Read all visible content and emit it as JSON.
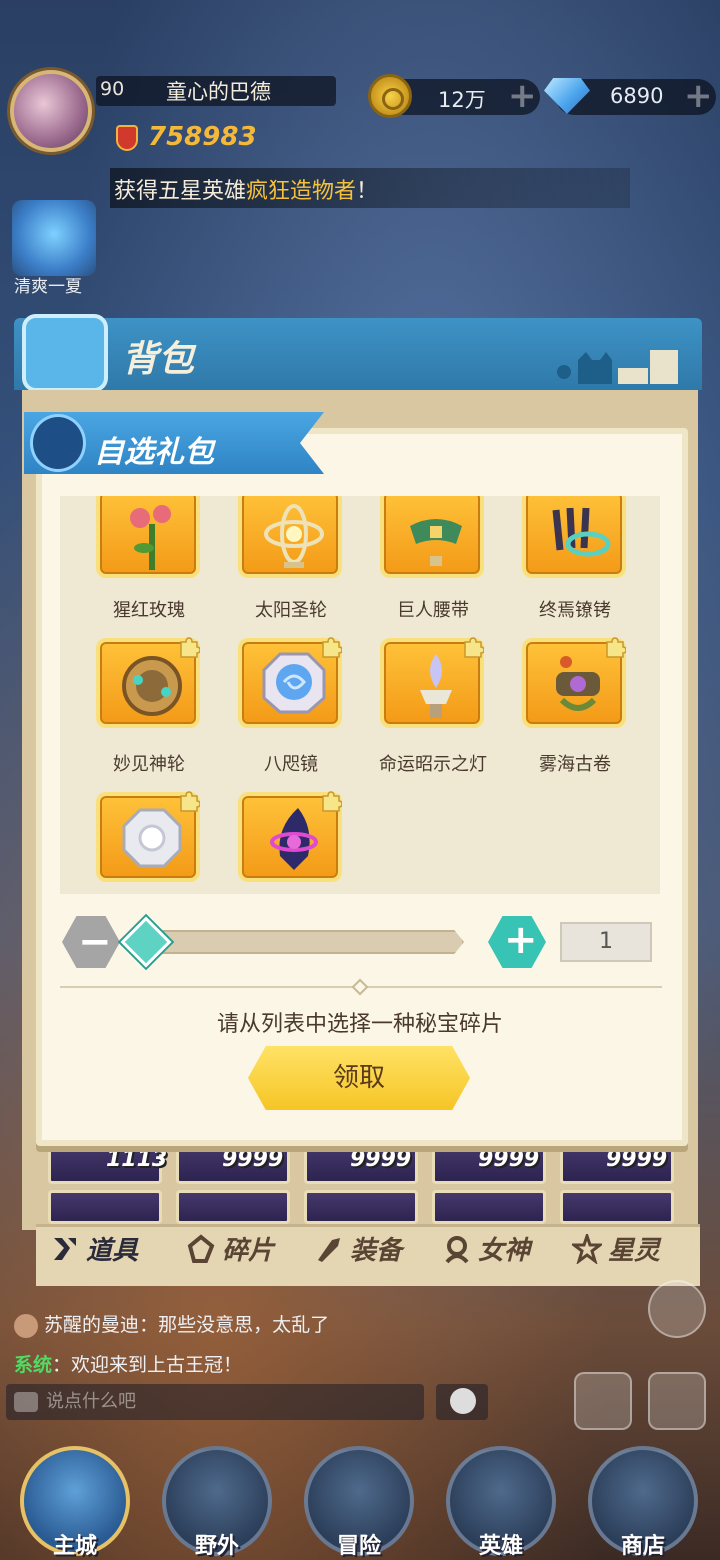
{
  "player": {
    "level": "90",
    "name": "童心的巴德",
    "power": "758983"
  },
  "resources": {
    "gold": "12万",
    "diamonds": "6890"
  },
  "ticker": {
    "prefix": "获得五星英雄",
    "highlight": "疯狂造物者",
    "suffix": "！"
  },
  "pet": {
    "label": "清爽一夏"
  },
  "bag": {
    "title": "背包",
    "grid_counts": [
      "1113",
      "9999",
      "9999",
      "9999",
      "9999"
    ],
    "tabs": [
      {
        "label": "道具",
        "icon": "items-icon"
      },
      {
        "label": "碎片",
        "icon": "shards-icon"
      },
      {
        "label": "装备",
        "icon": "equipment-icon"
      },
      {
        "label": "女神",
        "icon": "goddess-icon"
      },
      {
        "label": "星灵",
        "icon": "star-spirit-icon"
      }
    ]
  },
  "modal": {
    "title": "自选礼包",
    "items": [
      {
        "name": "猩红玫瑰",
        "icon": "crimson-rose-icon"
      },
      {
        "name": "太阳圣轮",
        "icon": "sun-wheel-icon"
      },
      {
        "name": "巨人腰带",
        "icon": "giant-belt-icon"
      },
      {
        "name": "终焉镣铐",
        "icon": "shackles-icon"
      },
      {
        "name": "妙见神轮",
        "icon": "divine-wheel-icon"
      },
      {
        "name": "八咫镜",
        "icon": "yata-mirror-icon"
      },
      {
        "name": "命运昭示之灯",
        "icon": "fate-lamp-icon"
      },
      {
        "name": "雾海古卷",
        "icon": "mist-scroll-icon"
      },
      {
        "name": "",
        "icon": "silver-relic-icon"
      },
      {
        "name": "",
        "icon": "dark-eye-icon"
      }
    ],
    "quantity": "1",
    "slider_value": 0,
    "hint": "请从列表中选择一种秘宝碎片",
    "claim_label": "领取",
    "colors": {
      "accent": "#f6c526",
      "teal": "#38c4b4"
    }
  },
  "chat": {
    "lines": [
      {
        "sender": "苏醒的曼迪",
        "text": "那些没意思，太乱了"
      },
      {
        "tag": "系统",
        "text": "欢迎来到上古王冠！"
      }
    ],
    "input_placeholder": "说点什么吧"
  },
  "nav": [
    {
      "label": "主城",
      "icon": "castle-icon"
    },
    {
      "label": "野外",
      "icon": "wild-icon"
    },
    {
      "label": "冒险",
      "icon": "sword-icon"
    },
    {
      "label": "英雄",
      "icon": "helmet-icon"
    },
    {
      "label": "商店",
      "icon": "shop-icon"
    }
  ]
}
